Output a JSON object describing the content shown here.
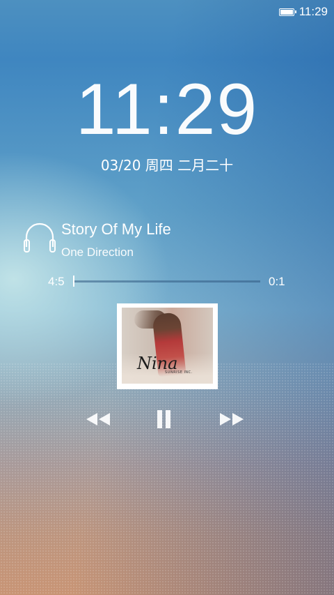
{
  "status_bar": {
    "battery_icon": "battery-full-icon",
    "time": "11:29"
  },
  "lockscreen": {
    "clock": "11:29",
    "date": "03/20 周四 二月二十"
  },
  "music": {
    "icon": "headphones-icon",
    "song_title": "Story Of My Life",
    "artist": "One Direction",
    "time_elapsed": "4:5",
    "time_remaining": "0:1",
    "progress_fraction": 0.0,
    "album_art": {
      "logo_text": "Nina",
      "subtitle_text": "SUNRISE INC."
    },
    "controls": {
      "rewind_icon": "rewind-icon",
      "pause_icon": "pause-icon",
      "forward_icon": "fast-forward-icon"
    }
  },
  "colors": {
    "text": "#ffffff",
    "progress_track": "#325a82"
  }
}
